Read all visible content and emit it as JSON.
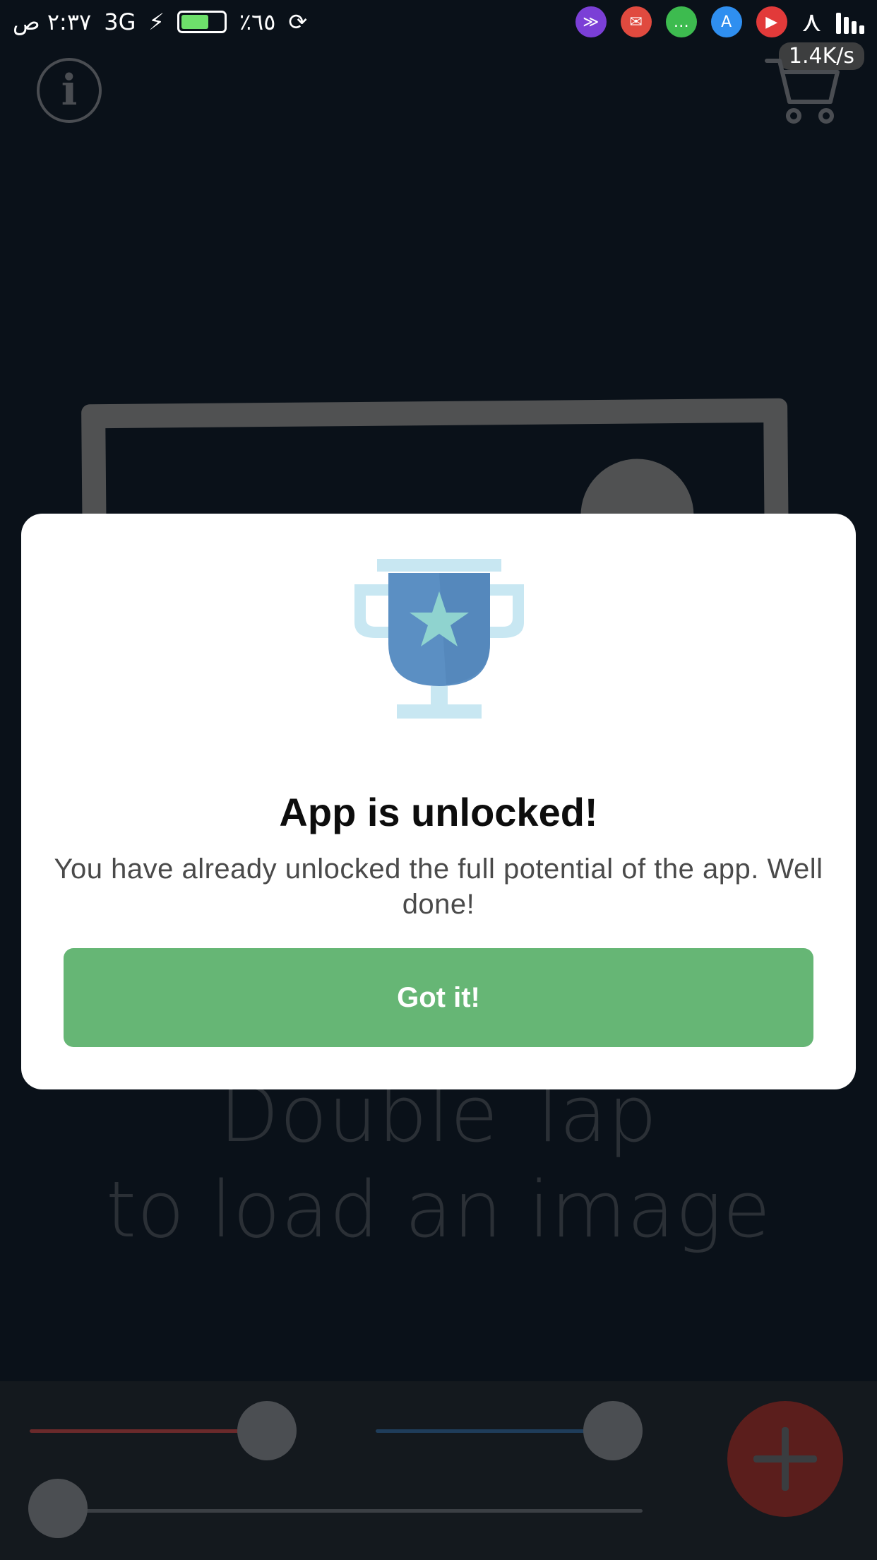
{
  "status_bar": {
    "time": "٢:٣٧ ص",
    "network": "3G",
    "battery_percent": "٪٦٥",
    "battery_level": 0.65,
    "speed": "1.4K/s"
  },
  "background": {
    "hint_line1": "Double Tap",
    "hint_line2": "to load an image"
  },
  "controls": {
    "red_slider_level": 0.87,
    "blue_slider_level": 0.89,
    "gray_slider_level": 0.0,
    "colors": {
      "red_track": "#6b2a2b",
      "blue_track": "#1f3d5b",
      "gray_track": "#3b3f44",
      "fab": "#5b1e1c"
    }
  },
  "modal": {
    "title": "App is unlocked!",
    "message": "You have already unlocked the full potential of the app. Well done!",
    "button_label": "Got it!",
    "colors": {
      "button": "#66b675",
      "trophy_cup": "#5b8fc3",
      "trophy_accent": "#c8e7f2",
      "star": "#8fd3cf"
    }
  }
}
